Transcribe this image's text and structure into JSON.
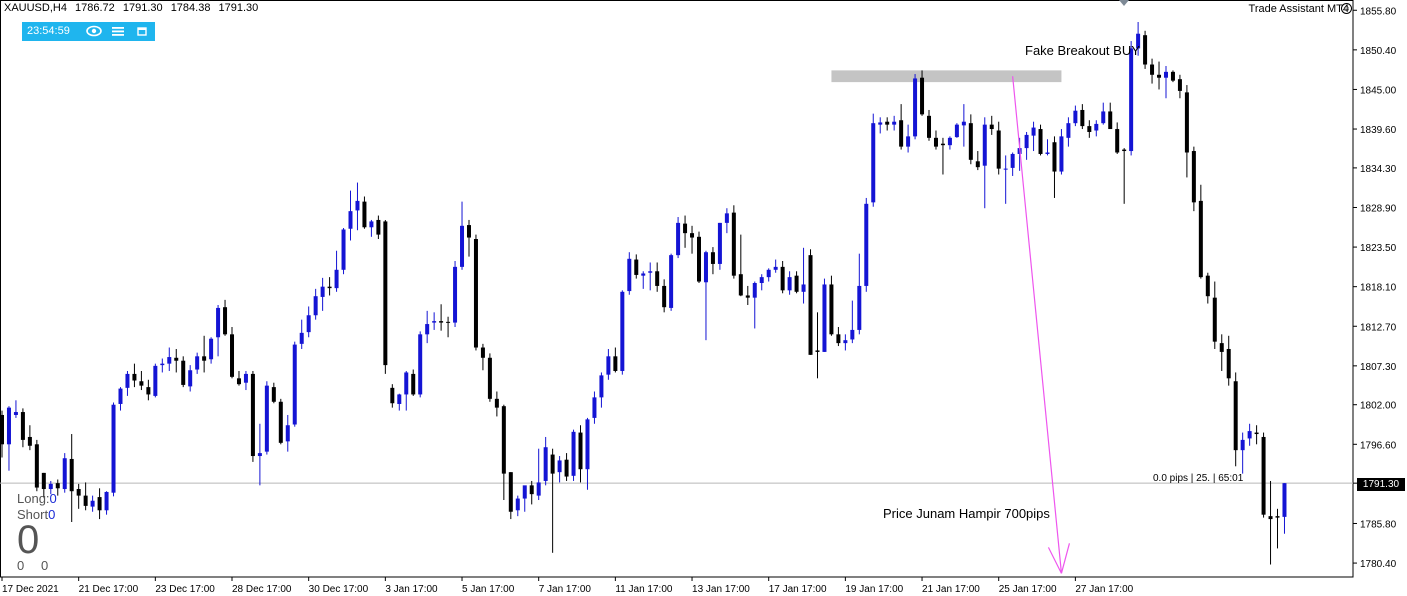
{
  "header": {
    "symbol": "XAUUSD,H4",
    "open": "1786.72",
    "high": "1791.30",
    "low": "1784.38",
    "close": "1791.30"
  },
  "widget": {
    "time": "23:54:59",
    "eye_icon": "eye-icon",
    "menu_icon": "menu-icon",
    "window_icon": "window-icon"
  },
  "trade_assistant": {
    "label": "Trade Assistant MT4",
    "icon": "smiley-icon"
  },
  "positions": {
    "long_label": "Long:",
    "long_value": "0",
    "short_label": "Short",
    "short_value": "0",
    "big_value": "0",
    "small_left": "0",
    "small_right": "0"
  },
  "annotations": {
    "fake_breakout": "Fake Breakout BUY",
    "drop_text": "Price Junam Hampir 700pips",
    "pip_info": "0.0 pips | 25. | 65:01"
  },
  "current_price_label": "1791.30",
  "colors": {
    "bull": "#1414d4",
    "bear": "#000000",
    "zone": "#c4c4c4",
    "arrow": "#ee55ee",
    "widget": "#1fb5ee"
  },
  "chart_data": {
    "type": "candlestick",
    "title": "XAUUSD,H4",
    "ylim": [
      1778.5,
      1857.2
    ],
    "current_price": 1791.3,
    "y_ticks": [
      "1855.80",
      "1850.40",
      "1845.00",
      "1839.60",
      "1834.30",
      "1828.90",
      "1823.50",
      "1818.10",
      "1812.70",
      "1807.30",
      "1802.00",
      "1796.60",
      "1791.30",
      "1785.80",
      "1780.40"
    ],
    "x_ticks": [
      {
        "label": "17 Dec 2021",
        "index": 0
      },
      {
        "label": "21 Dec 17:00",
        "index": 11
      },
      {
        "label": "23 Dec 17:00",
        "index": 22
      },
      {
        "label": "28 Dec 17:00",
        "index": 33
      },
      {
        "label": "30 Dec 17:00",
        "index": 44
      },
      {
        "label": "3 Jan 17:00",
        "index": 55
      },
      {
        "label": "5 Jan 17:00",
        "index": 66
      },
      {
        "label": "7 Jan 17:00",
        "index": 77
      },
      {
        "label": "11 Jan 17:00",
        "index": 88
      },
      {
        "label": "13 Jan 17:00",
        "index": 99
      },
      {
        "label": "17 Jan 17:00",
        "index": 110
      },
      {
        "label": "19 Jan 17:00",
        "index": 121
      },
      {
        "label": "21 Jan 17:00",
        "index": 132
      },
      {
        "label": "25 Jan 17:00",
        "index": 143
      },
      {
        "label": "27 Jan 17:00",
        "index": 154
      }
    ],
    "fake_breakout_zone": {
      "from_index": 119,
      "to_index": 152,
      "top": 1847.6,
      "bottom": 1846.0
    },
    "arrow": {
      "from_index": 145,
      "from_price": 1846.8,
      "to_index": 152,
      "to_price": 1779.0
    },
    "candles": [
      [
        1800.6,
        1801.2,
        1794.8,
        1796.6
      ],
      [
        1796.6,
        1801.8,
        1793.0,
        1801.6
      ],
      [
        1800.6,
        1802.6,
        1800.2,
        1801.0
      ],
      [
        1801.0,
        1801.5,
        1796.2,
        1797.2
      ],
      [
        1797.6,
        1799.2,
        1795.8,
        1796.4
      ],
      [
        1796.6,
        1797.2,
        1790.2,
        1790.7
      ],
      [
        1792.7,
        1792.7,
        1789.4,
        1790.5
      ],
      [
        1790.5,
        1791.6,
        1789.8,
        1791.2
      ],
      [
        1791.3,
        1791.8,
        1789.6,
        1790.6
      ],
      [
        1790.5,
        1795.4,
        1790.0,
        1794.7
      ],
      [
        1794.6,
        1798.0,
        1786.0,
        1790.2
      ],
      [
        1790.5,
        1791.2,
        1787.8,
        1789.6
      ],
      [
        1789.6,
        1791.4,
        1787.6,
        1788.2
      ],
      [
        1788.1,
        1789.6,
        1787.4,
        1788.9
      ],
      [
        1789.4,
        1790.6,
        1786.4,
        1787.6
      ],
      [
        1787.6,
        1790.2,
        1787.0,
        1790.1
      ],
      [
        1790.0,
        1802.3,
        1789.5,
        1802.0
      ],
      [
        1802.1,
        1804.4,
        1801.2,
        1804.2
      ],
      [
        1804.3,
        1806.6,
        1803.2,
        1806.2
      ],
      [
        1806.2,
        1807.6,
        1804.4,
        1805.3
      ],
      [
        1805.2,
        1806.6,
        1804.0,
        1804.6
      ],
      [
        1804.4,
        1805.4,
        1802.6,
        1803.4
      ],
      [
        1803.2,
        1807.6,
        1803.0,
        1807.3
      ],
      [
        1807.4,
        1808.3,
        1806.4,
        1807.6
      ],
      [
        1807.6,
        1809.8,
        1806.6,
        1808.5
      ],
      [
        1808.4,
        1809.6,
        1806.4,
        1808.0
      ],
      [
        1808.0,
        1808.6,
        1804.4,
        1804.7
      ],
      [
        1804.5,
        1807.4,
        1803.8,
        1806.7
      ],
      [
        1806.8,
        1809.1,
        1806.2,
        1808.6
      ],
      [
        1808.6,
        1811.4,
        1806.4,
        1808.0
      ],
      [
        1808.2,
        1811.2,
        1807.6,
        1811.0
      ],
      [
        1811.2,
        1815.6,
        1808.6,
        1815.2
      ],
      [
        1815.3,
        1816.3,
        1811.4,
        1811.6
      ],
      [
        1811.6,
        1812.6,
        1805.6,
        1805.8
      ],
      [
        1805.6,
        1806.6,
        1804.6,
        1804.8
      ],
      [
        1805.0,
        1806.6,
        1804.0,
        1806.2
      ],
      [
        1806.2,
        1806.6,
        1794.2,
        1795.0
      ],
      [
        1795.0,
        1799.4,
        1791.0,
        1795.4
      ],
      [
        1795.6,
        1805.2,
        1795.2,
        1804.6
      ],
      [
        1804.4,
        1805.0,
        1802.2,
        1802.4
      ],
      [
        1802.4,
        1802.8,
        1796.6,
        1796.8
      ],
      [
        1797.0,
        1800.6,
        1795.6,
        1799.2
      ],
      [
        1799.3,
        1810.6,
        1799.0,
        1810.2
      ],
      [
        1810.3,
        1813.6,
        1809.6,
        1811.8
      ],
      [
        1811.9,
        1815.4,
        1811.2,
        1814.2
      ],
      [
        1814.2,
        1817.8,
        1813.6,
        1816.8
      ],
      [
        1816.7,
        1819.3,
        1814.8,
        1818.1
      ],
      [
        1818.1,
        1819.4,
        1816.9,
        1817.9
      ],
      [
        1817.9,
        1823.0,
        1817.4,
        1820.4
      ],
      [
        1820.4,
        1826.1,
        1819.8,
        1825.9
      ],
      [
        1826.0,
        1831.2,
        1824.4,
        1828.4
      ],
      [
        1828.5,
        1832.3,
        1825.8,
        1829.8
      ],
      [
        1829.7,
        1830.4,
        1826.0,
        1826.2
      ],
      [
        1826.2,
        1827.2,
        1824.9,
        1827.0
      ],
      [
        1827.2,
        1827.8,
        1824.6,
        1825.2
      ],
      [
        1827.0,
        1827.2,
        1806.2,
        1807.4
      ],
      [
        1804.3,
        1804.8,
        1801.6,
        1802.2
      ],
      [
        1802.1,
        1803.5,
        1801.2,
        1803.4
      ],
      [
        1803.4,
        1806.6,
        1801.2,
        1806.4
      ],
      [
        1806.2,
        1806.8,
        1803.2,
        1803.4
      ],
      [
        1803.4,
        1812.0,
        1803.0,
        1811.6
      ],
      [
        1811.6,
        1814.8,
        1810.4,
        1813.0
      ],
      [
        1813.2,
        1814.6,
        1812.2,
        1813.4
      ],
      [
        1813.4,
        1815.7,
        1812.1,
        1813.2
      ],
      [
        1813.3,
        1814.0,
        1811.2,
        1813.2
      ],
      [
        1813.2,
        1821.6,
        1812.6,
        1820.8
      ],
      [
        1820.8,
        1829.7,
        1820.4,
        1826.4
      ],
      [
        1826.5,
        1827.2,
        1822.2,
        1824.8
      ],
      [
        1824.6,
        1825.2,
        1809.4,
        1809.8
      ],
      [
        1809.8,
        1810.3,
        1806.7,
        1808.4
      ],
      [
        1808.4,
        1809.0,
        1802.4,
        1802.8
      ],
      [
        1802.8,
        1803.8,
        1800.4,
        1801.6
      ],
      [
        1801.8,
        1802.0,
        1789.0,
        1792.6
      ],
      [
        1792.8,
        1792.8,
        1786.4,
        1787.4
      ],
      [
        1787.6,
        1789.6,
        1786.8,
        1789.2
      ],
      [
        1789.2,
        1790.4,
        1787.4,
        1791.0
      ],
      [
        1791.0,
        1791.6,
        1788.4,
        1789.8
      ],
      [
        1789.6,
        1796.0,
        1789.0,
        1791.4
      ],
      [
        1791.6,
        1797.6,
        1791.0,
        1796.2
      ],
      [
        1795.2,
        1796.0,
        1781.8,
        1792.6
      ],
      [
        1792.8,
        1795.0,
        1791.4,
        1794.4
      ],
      [
        1794.5,
        1795.4,
        1791.6,
        1792.2
      ],
      [
        1792.3,
        1798.6,
        1791.6,
        1798.3
      ],
      [
        1798.2,
        1799.2,
        1791.4,
        1793.2
      ],
      [
        1793.2,
        1800.2,
        1790.4,
        1800.0
      ],
      [
        1800.2,
        1803.8,
        1799.4,
        1803.0
      ],
      [
        1803.0,
        1806.4,
        1801.6,
        1806.0
      ],
      [
        1806.1,
        1809.6,
        1805.4,
        1808.6
      ],
      [
        1808.6,
        1809.8,
        1806.4,
        1806.6
      ],
      [
        1806.6,
        1817.6,
        1806.1,
        1817.4
      ],
      [
        1817.5,
        1822.8,
        1817.0,
        1821.9
      ],
      [
        1821.8,
        1822.5,
        1819.2,
        1819.7
      ],
      [
        1819.6,
        1820.2,
        1817.8,
        1819.9
      ],
      [
        1820.0,
        1821.4,
        1817.6,
        1820.2
      ],
      [
        1820.2,
        1821.4,
        1817.4,
        1818.2
      ],
      [
        1818.2,
        1819.1,
        1814.6,
        1815.3
      ],
      [
        1815.2,
        1822.6,
        1814.8,
        1822.4
      ],
      [
        1822.4,
        1827.6,
        1822.0,
        1826.8
      ],
      [
        1826.7,
        1827.8,
        1823.4,
        1825.4
      ],
      [
        1825.4,
        1826.4,
        1822.6,
        1824.8
      ],
      [
        1824.9,
        1825.6,
        1818.6,
        1818.8
      ],
      [
        1818.7,
        1823.0,
        1810.8,
        1822.8
      ],
      [
        1822.8,
        1823.5,
        1819.8,
        1821.2
      ],
      [
        1821.2,
        1826.8,
        1820.4,
        1826.8
      ],
      [
        1826.8,
        1828.8,
        1825.4,
        1828.1
      ],
      [
        1828.2,
        1829.2,
        1819.2,
        1819.6
      ],
      [
        1819.8,
        1825.2,
        1816.8,
        1816.9
      ],
      [
        1816.9,
        1818.2,
        1815.6,
        1816.6
      ],
      [
        1816.6,
        1818.8,
        1812.4,
        1818.6
      ],
      [
        1818.6,
        1819.8,
        1817.6,
        1819.4
      ],
      [
        1819.4,
        1820.6,
        1818.8,
        1820.4
      ],
      [
        1820.4,
        1821.8,
        1820.0,
        1820.8
      ],
      [
        1820.8,
        1821.6,
        1817.2,
        1817.6
      ],
      [
        1817.6,
        1820.2,
        1817.0,
        1819.4
      ],
      [
        1819.6,
        1820.2,
        1817.2,
        1817.4
      ],
      [
        1817.4,
        1823.4,
        1815.8,
        1818.4
      ],
      [
        1822.4,
        1823.2,
        1808.8,
        1808.8
      ],
      [
        1809.4,
        1814.6,
        1805.6,
        1809.2
      ],
      [
        1809.2,
        1819.2,
        1809.2,
        1818.4
      ],
      [
        1818.4,
        1819.6,
        1811.4,
        1811.6
      ],
      [
        1811.6,
        1812.6,
        1810.0,
        1810.4
      ],
      [
        1810.4,
        1811.6,
        1809.4,
        1810.8
      ],
      [
        1810.9,
        1816.2,
        1810.4,
        1812.2
      ],
      [
        1812.2,
        1822.6,
        1811.6,
        1818.2
      ],
      [
        1818.2,
        1830.2,
        1817.4,
        1829.4
      ],
      [
        1829.6,
        1841.7,
        1829.0,
        1840.4
      ],
      [
        1840.2,
        1841.2,
        1839.0,
        1840.5
      ],
      [
        1840.6,
        1841.2,
        1839.4,
        1840.2
      ],
      [
        1840.2,
        1841.4,
        1839.4,
        1840.6
      ],
      [
        1840.8,
        1843.0,
        1836.8,
        1837.2
      ],
      [
        1837.2,
        1840.2,
        1836.4,
        1838.6
      ],
      [
        1838.6,
        1847.1,
        1838.2,
        1846.5
      ],
      [
        1846.6,
        1847.6,
        1841.4,
        1841.6
      ],
      [
        1841.4,
        1842.2,
        1838.0,
        1838.4
      ],
      [
        1838.4,
        1839.4,
        1836.8,
        1837.2
      ],
      [
        1837.6,
        1838.4,
        1833.4,
        1837.4
      ],
      [
        1837.4,
        1838.6,
        1836.8,
        1838.4
      ],
      [
        1838.5,
        1840.4,
        1838.4,
        1840.2
      ],
      [
        1840.1,
        1843.0,
        1837.2,
        1840.6
      ],
      [
        1840.4,
        1841.6,
        1834.8,
        1835.4
      ],
      [
        1835.2,
        1836.6,
        1834.0,
        1834.4
      ],
      [
        1834.6,
        1841.2,
        1828.8,
        1840.2
      ],
      [
        1840.2,
        1841.4,
        1838.8,
        1839.6
      ],
      [
        1839.4,
        1840.6,
        1833.4,
        1834.2
      ],
      [
        1834.2,
        1836.0,
        1829.4,
        1834.2
      ],
      [
        1834.3,
        1836.4,
        1833.2,
        1836.2
      ],
      [
        1836.2,
        1838.4,
        1833.9,
        1837.0
      ],
      [
        1837.0,
        1839.2,
        1835.4,
        1838.8
      ],
      [
        1838.7,
        1840.6,
        1836.6,
        1839.8
      ],
      [
        1839.6,
        1840.2,
        1836.0,
        1836.2
      ],
      [
        1836.2,
        1838.2,
        1836.0,
        1836.4
      ],
      [
        1837.8,
        1838.6,
        1830.2,
        1833.8
      ],
      [
        1833.8,
        1839.6,
        1833.4,
        1838.6
      ],
      [
        1838.4,
        1841.2,
        1837.2,
        1840.4
      ],
      [
        1840.4,
        1842.8,
        1840.0,
        1842.1
      ],
      [
        1842.2,
        1843.0,
        1839.6,
        1840.0
      ],
      [
        1840.0,
        1840.8,
        1838.4,
        1839.2
      ],
      [
        1839.4,
        1840.8,
        1838.6,
        1840.3
      ],
      [
        1840.4,
        1843.2,
        1840.2,
        1842.0
      ],
      [
        1842.0,
        1843.2,
        1839.8,
        1839.6
      ],
      [
        1839.6,
        1840.5,
        1836.2,
        1836.4
      ],
      [
        1836.8,
        1837.0,
        1829.4,
        1836.6
      ],
      [
        1836.6,
        1851.6,
        1836.0,
        1850.6
      ],
      [
        1850.6,
        1854.2,
        1849.6,
        1852.6
      ],
      [
        1852.4,
        1853.0,
        1847.8,
        1848.4
      ],
      [
        1848.4,
        1849.2,
        1845.8,
        1847.0
      ],
      [
        1847.0,
        1848.8,
        1845.0,
        1846.6
      ],
      [
        1846.6,
        1848.2,
        1843.8,
        1847.4
      ],
      [
        1847.4,
        1847.6,
        1846.0,
        1846.2
      ],
      [
        1846.4,
        1847.0,
        1843.8,
        1844.8
      ],
      [
        1844.6,
        1845.6,
        1833.0,
        1836.4
      ],
      [
        1836.6,
        1837.2,
        1828.4,
        1829.6
      ],
      [
        1829.8,
        1832.0,
        1819.2,
        1819.4
      ],
      [
        1819.6,
        1820.0,
        1815.8,
        1816.8
      ],
      [
        1816.6,
        1818.8,
        1809.6,
        1810.6
      ],
      [
        1810.4,
        1811.6,
        1806.6,
        1809.2
      ],
      [
        1809.6,
        1811.4,
        1804.6,
        1805.6
      ],
      [
        1805.2,
        1806.4,
        1793.6,
        1795.8
      ],
      [
        1795.8,
        1798.2,
        1792.6,
        1797.2
      ],
      [
        1797.4,
        1799.4,
        1796.4,
        1798.4
      ],
      [
        1798.2,
        1799.2,
        1796.6,
        1798.0
      ],
      [
        1797.6,
        1798.2,
        1786.6,
        1787.0
      ],
      [
        1786.8,
        1791.6,
        1780.2,
        1786.4
      ],
      [
        1786.8,
        1787.8,
        1782.4,
        1786.6
      ],
      [
        1786.7,
        1791.3,
        1784.4,
        1791.3
      ]
    ]
  }
}
